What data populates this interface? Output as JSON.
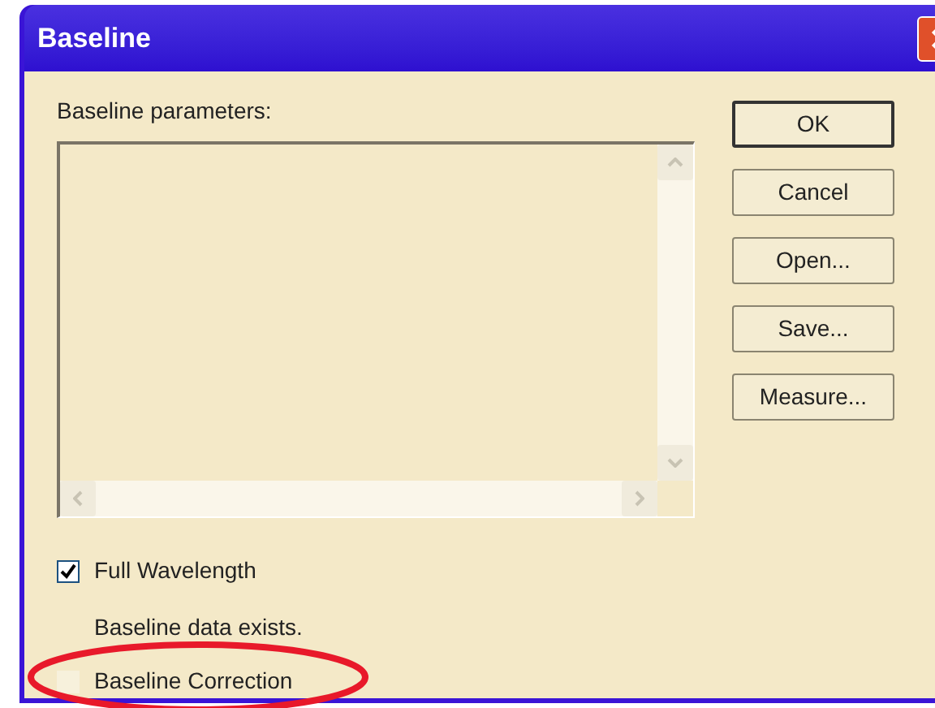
{
  "window": {
    "title": "Baseline"
  },
  "parameters": {
    "label": "Baseline parameters:"
  },
  "buttons": [
    {
      "label": "OK",
      "default": true
    },
    {
      "label": "Cancel",
      "default": false
    },
    {
      "label": "Open...",
      "default": false
    },
    {
      "label": "Save...",
      "default": false
    },
    {
      "label": "Measure...",
      "default": false
    }
  ],
  "full_wavelength": {
    "label": "Full Wavelength",
    "checked": true
  },
  "status": "Baseline data exists.",
  "baseline_correction": {
    "label": "Baseline Correction",
    "checked": false
  }
}
